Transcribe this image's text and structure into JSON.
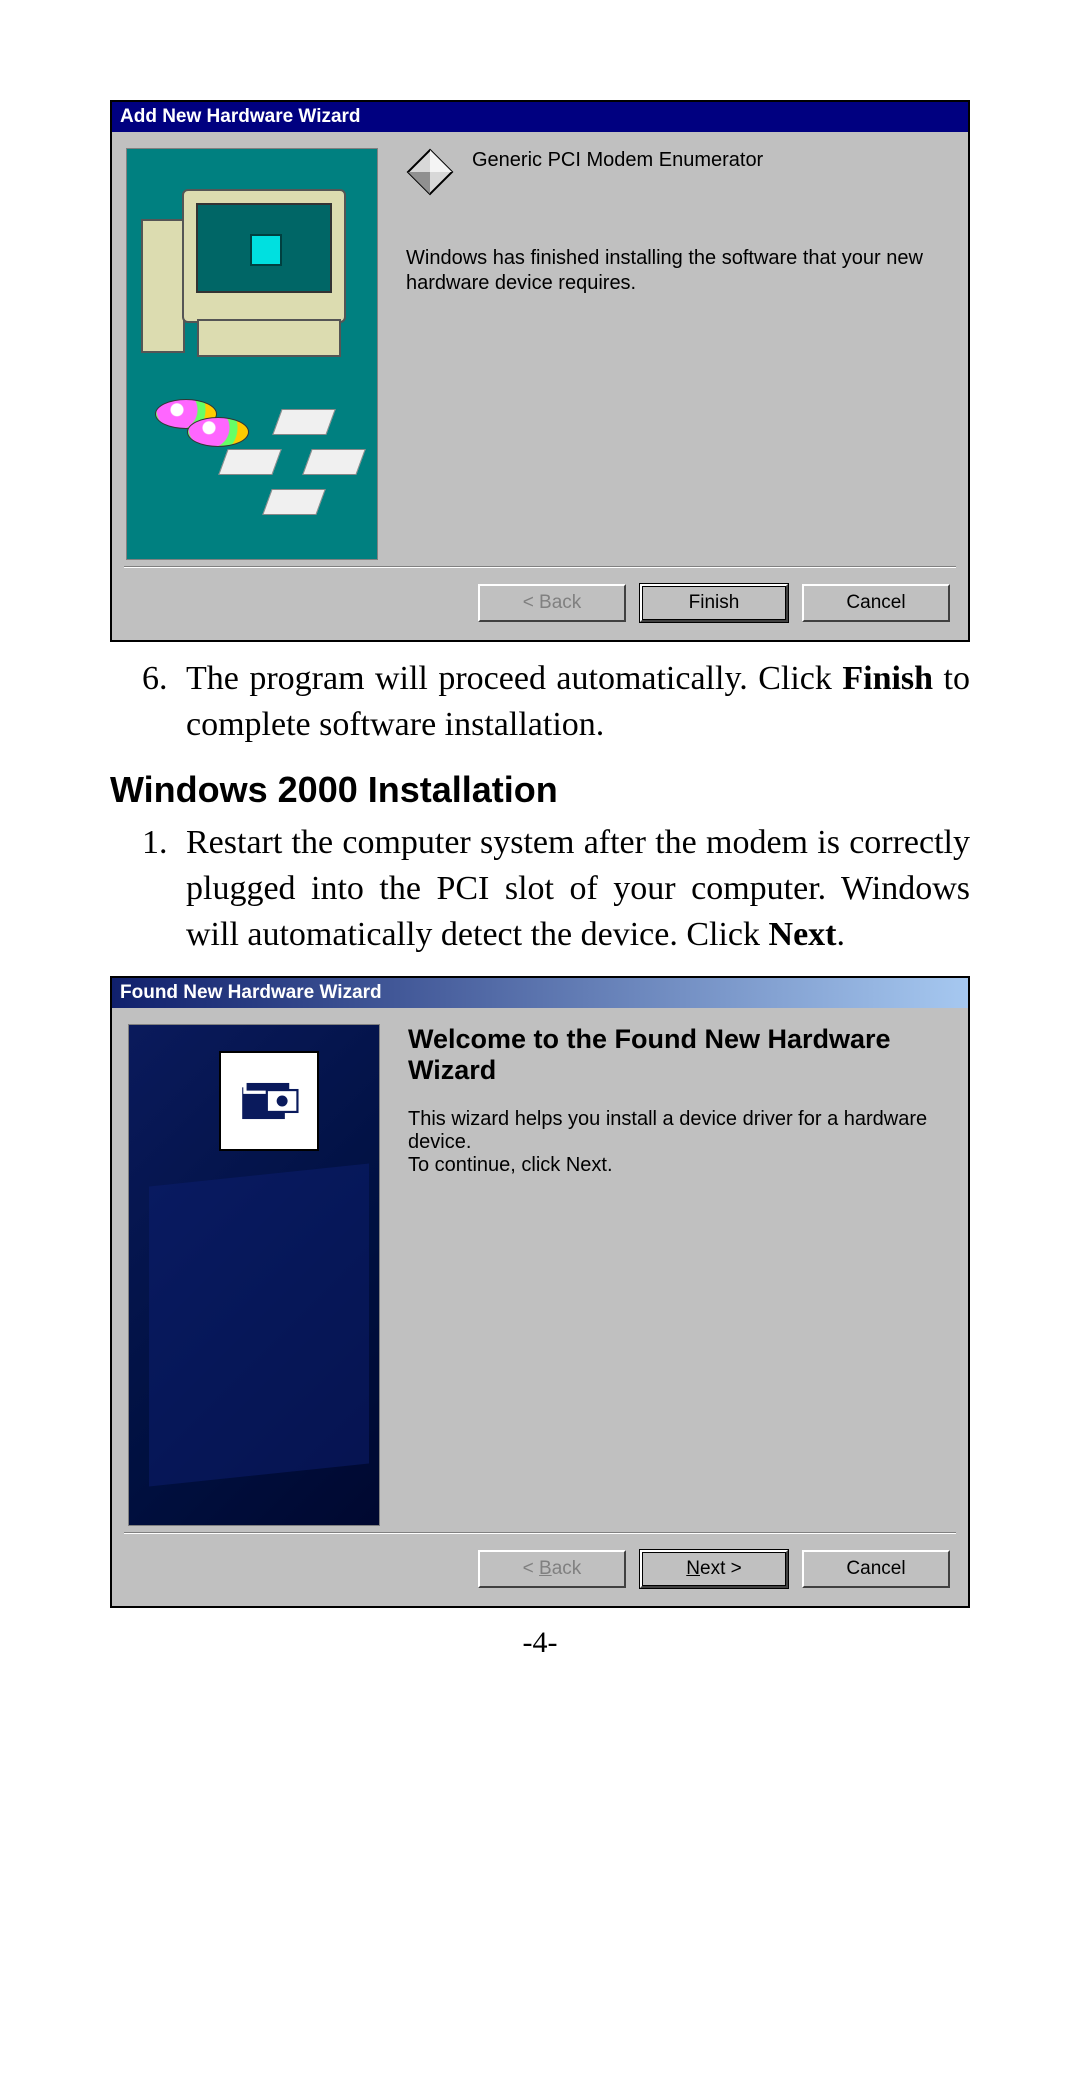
{
  "dialog1": {
    "title": "Add New Hardware Wizard",
    "device_name": "Generic PCI Modem Enumerator",
    "message": "Windows has finished installing the software that your new hardware device requires.",
    "buttons": {
      "back": "< Back",
      "finish": "Finish",
      "cancel": "Cancel"
    }
  },
  "step6": {
    "text_before_bold": "The program will proceed automatically. Click ",
    "bold": "Finish",
    "text_after_bold": " to complete software installation."
  },
  "section_heading": "Windows 2000 Installation",
  "step1": {
    "text_before_bold": "Restart the computer system after the modem is correctly plugged into the PCI slot of your computer. Windows will automatically detect the device.  Click ",
    "bold": "Next",
    "text_after_bold": "."
  },
  "dialog2": {
    "title": "Found New Hardware Wizard",
    "heading": "Welcome to the Found New Hardware Wizard",
    "body": "This wizard helps you install a device driver for a hardware device.",
    "continue": "To continue, click Next.",
    "buttons": {
      "back_prefix": "< ",
      "back_u": "B",
      "back_rest": "ack",
      "next_u": "N",
      "next_rest": "ext >",
      "cancel": "Cancel"
    }
  },
  "page_number": "-4-"
}
